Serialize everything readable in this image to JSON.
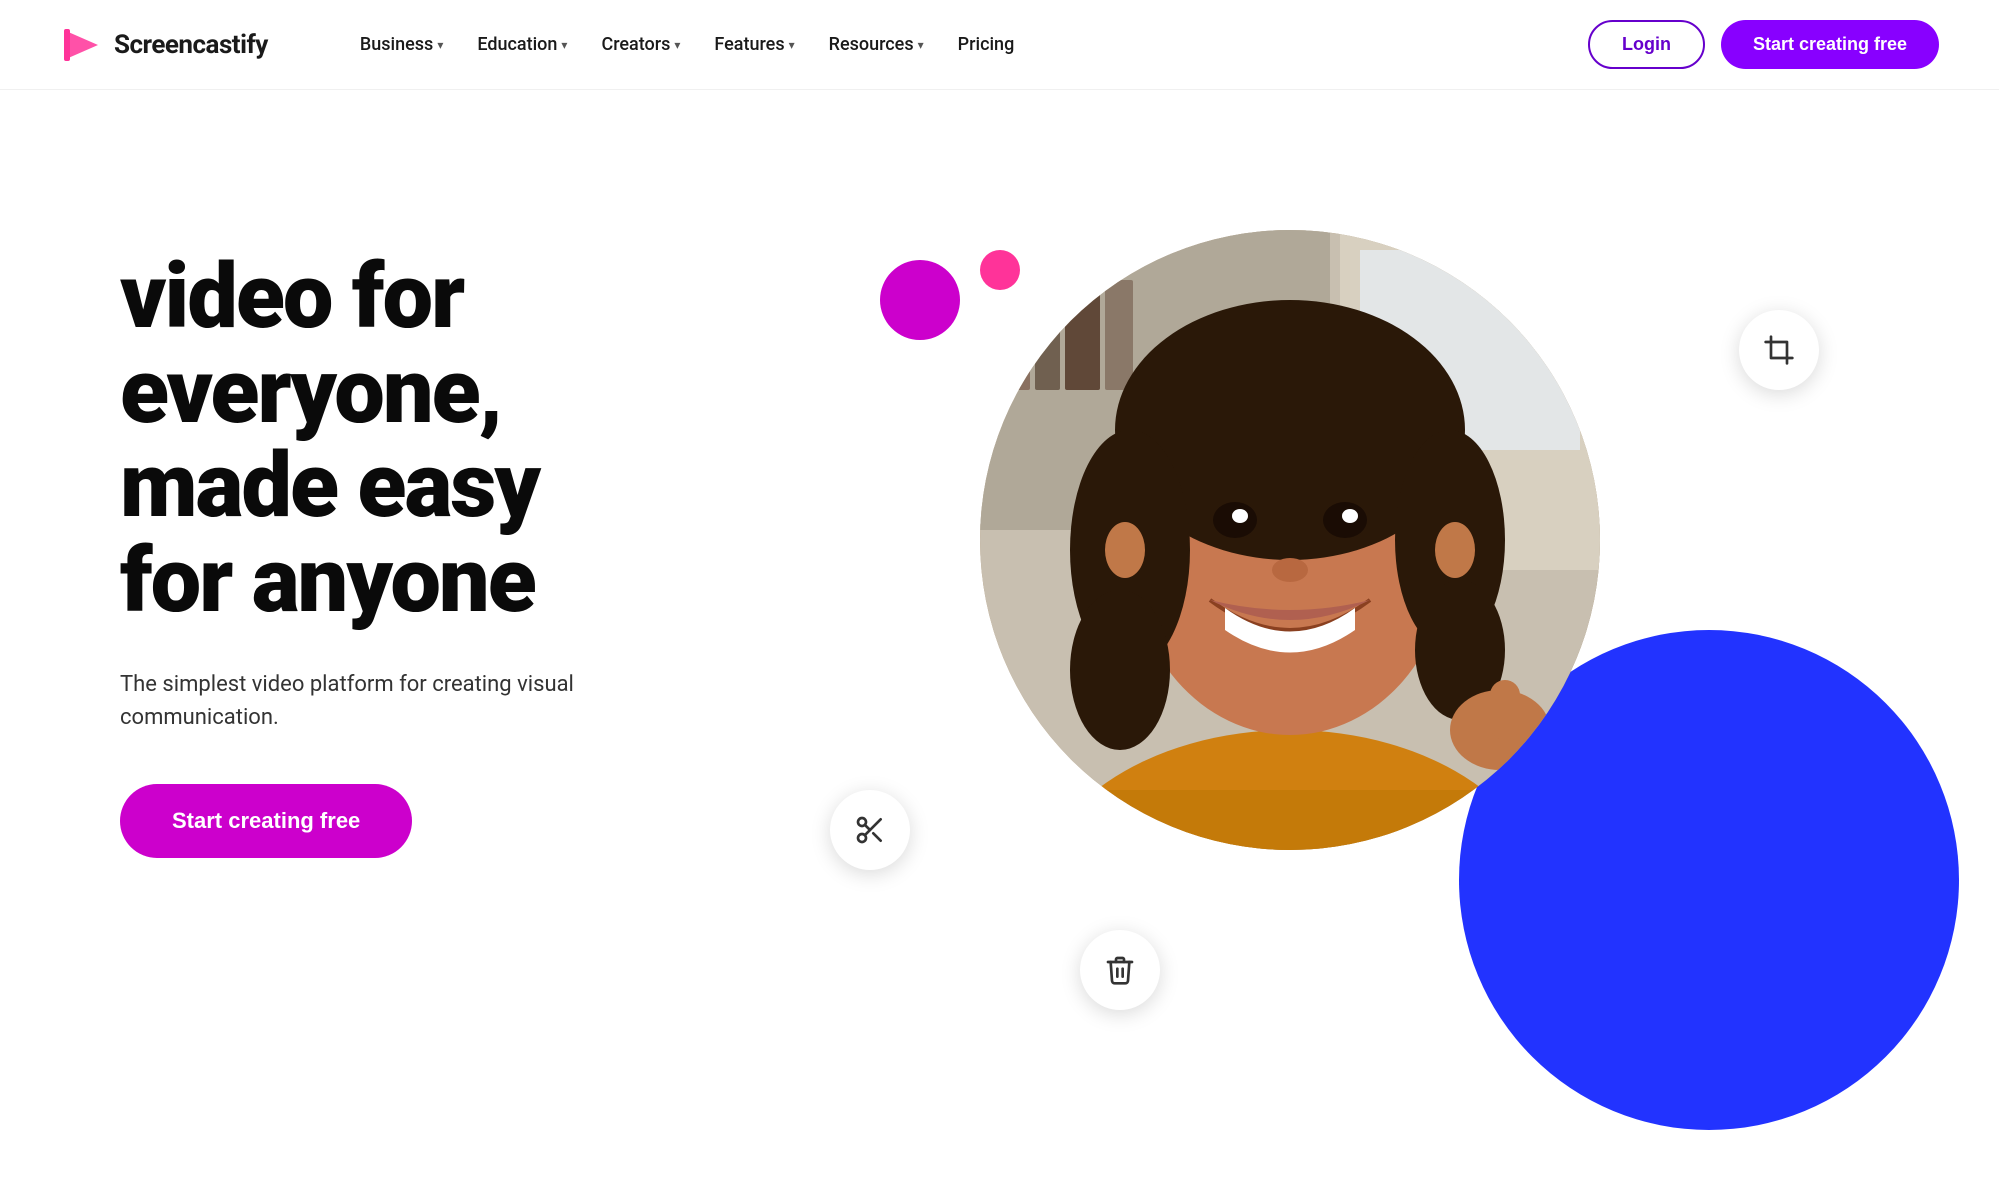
{
  "logo": {
    "text": "Screencastify"
  },
  "nav": {
    "items": [
      {
        "id": "business",
        "label": "Business",
        "hasDropdown": true
      },
      {
        "id": "education",
        "label": "Education",
        "hasDropdown": true
      },
      {
        "id": "creators",
        "label": "Creators",
        "hasDropdown": true
      },
      {
        "id": "features",
        "label": "Features",
        "hasDropdown": true
      },
      {
        "id": "resources",
        "label": "Resources",
        "hasDropdown": true
      }
    ],
    "pricing_label": "Pricing"
  },
  "header": {
    "login_label": "Login",
    "cta_label": "Start creating free"
  },
  "hero": {
    "headline_line1": "video for",
    "headline_line2": "everyone,",
    "headline_line3": "made easy",
    "headline_line4": "for anyone",
    "subtext": "The simplest video platform for creating visual communication.",
    "cta_label": "Start creating free"
  },
  "colors": {
    "brand_purple": "#8800ff",
    "brand_magenta": "#cc00cc",
    "brand_blue": "#2233ff",
    "dot_purple": "#cc00cc",
    "dot_pink": "#ff3399"
  }
}
